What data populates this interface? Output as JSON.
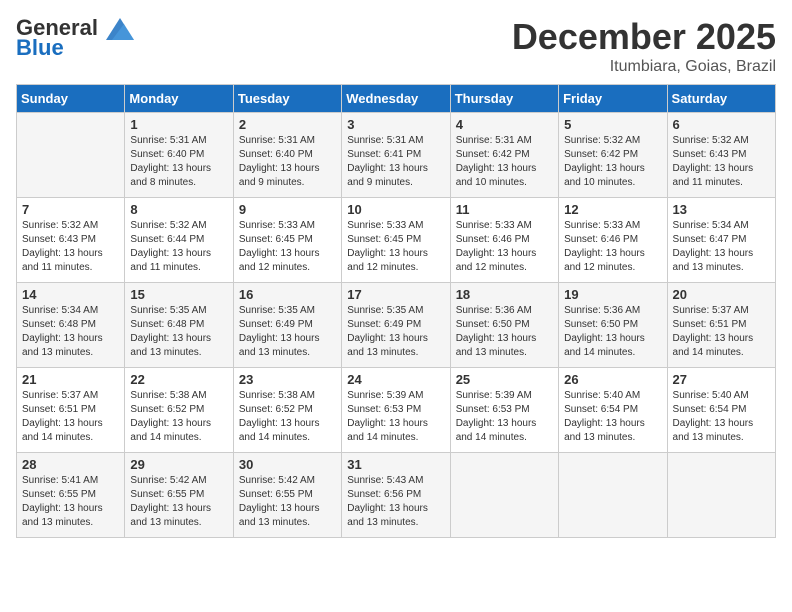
{
  "logo": {
    "line1": "General",
    "line2": "Blue"
  },
  "title": "December 2025",
  "location": "Itumbiara, Goias, Brazil",
  "days_of_week": [
    "Sunday",
    "Monday",
    "Tuesday",
    "Wednesday",
    "Thursday",
    "Friday",
    "Saturday"
  ],
  "weeks": [
    [
      {
        "num": "",
        "sunrise": "",
        "sunset": "",
        "daylight": ""
      },
      {
        "num": "1",
        "sunrise": "Sunrise: 5:31 AM",
        "sunset": "Sunset: 6:40 PM",
        "daylight": "Daylight: 13 hours and 8 minutes."
      },
      {
        "num": "2",
        "sunrise": "Sunrise: 5:31 AM",
        "sunset": "Sunset: 6:40 PM",
        "daylight": "Daylight: 13 hours and 9 minutes."
      },
      {
        "num": "3",
        "sunrise": "Sunrise: 5:31 AM",
        "sunset": "Sunset: 6:41 PM",
        "daylight": "Daylight: 13 hours and 9 minutes."
      },
      {
        "num": "4",
        "sunrise": "Sunrise: 5:31 AM",
        "sunset": "Sunset: 6:42 PM",
        "daylight": "Daylight: 13 hours and 10 minutes."
      },
      {
        "num": "5",
        "sunrise": "Sunrise: 5:32 AM",
        "sunset": "Sunset: 6:42 PM",
        "daylight": "Daylight: 13 hours and 10 minutes."
      },
      {
        "num": "6",
        "sunrise": "Sunrise: 5:32 AM",
        "sunset": "Sunset: 6:43 PM",
        "daylight": "Daylight: 13 hours and 11 minutes."
      }
    ],
    [
      {
        "num": "7",
        "sunrise": "Sunrise: 5:32 AM",
        "sunset": "Sunset: 6:43 PM",
        "daylight": "Daylight: 13 hours and 11 minutes."
      },
      {
        "num": "8",
        "sunrise": "Sunrise: 5:32 AM",
        "sunset": "Sunset: 6:44 PM",
        "daylight": "Daylight: 13 hours and 11 minutes."
      },
      {
        "num": "9",
        "sunrise": "Sunrise: 5:33 AM",
        "sunset": "Sunset: 6:45 PM",
        "daylight": "Daylight: 13 hours and 12 minutes."
      },
      {
        "num": "10",
        "sunrise": "Sunrise: 5:33 AM",
        "sunset": "Sunset: 6:45 PM",
        "daylight": "Daylight: 13 hours and 12 minutes."
      },
      {
        "num": "11",
        "sunrise": "Sunrise: 5:33 AM",
        "sunset": "Sunset: 6:46 PM",
        "daylight": "Daylight: 13 hours and 12 minutes."
      },
      {
        "num": "12",
        "sunrise": "Sunrise: 5:33 AM",
        "sunset": "Sunset: 6:46 PM",
        "daylight": "Daylight: 13 hours and 12 minutes."
      },
      {
        "num": "13",
        "sunrise": "Sunrise: 5:34 AM",
        "sunset": "Sunset: 6:47 PM",
        "daylight": "Daylight: 13 hours and 13 minutes."
      }
    ],
    [
      {
        "num": "14",
        "sunrise": "Sunrise: 5:34 AM",
        "sunset": "Sunset: 6:48 PM",
        "daylight": "Daylight: 13 hours and 13 minutes."
      },
      {
        "num": "15",
        "sunrise": "Sunrise: 5:35 AM",
        "sunset": "Sunset: 6:48 PM",
        "daylight": "Daylight: 13 hours and 13 minutes."
      },
      {
        "num": "16",
        "sunrise": "Sunrise: 5:35 AM",
        "sunset": "Sunset: 6:49 PM",
        "daylight": "Daylight: 13 hours and 13 minutes."
      },
      {
        "num": "17",
        "sunrise": "Sunrise: 5:35 AM",
        "sunset": "Sunset: 6:49 PM",
        "daylight": "Daylight: 13 hours and 13 minutes."
      },
      {
        "num": "18",
        "sunrise": "Sunrise: 5:36 AM",
        "sunset": "Sunset: 6:50 PM",
        "daylight": "Daylight: 13 hours and 13 minutes."
      },
      {
        "num": "19",
        "sunrise": "Sunrise: 5:36 AM",
        "sunset": "Sunset: 6:50 PM",
        "daylight": "Daylight: 13 hours and 14 minutes."
      },
      {
        "num": "20",
        "sunrise": "Sunrise: 5:37 AM",
        "sunset": "Sunset: 6:51 PM",
        "daylight": "Daylight: 13 hours and 14 minutes."
      }
    ],
    [
      {
        "num": "21",
        "sunrise": "Sunrise: 5:37 AM",
        "sunset": "Sunset: 6:51 PM",
        "daylight": "Daylight: 13 hours and 14 minutes."
      },
      {
        "num": "22",
        "sunrise": "Sunrise: 5:38 AM",
        "sunset": "Sunset: 6:52 PM",
        "daylight": "Daylight: 13 hours and 14 minutes."
      },
      {
        "num": "23",
        "sunrise": "Sunrise: 5:38 AM",
        "sunset": "Sunset: 6:52 PM",
        "daylight": "Daylight: 13 hours and 14 minutes."
      },
      {
        "num": "24",
        "sunrise": "Sunrise: 5:39 AM",
        "sunset": "Sunset: 6:53 PM",
        "daylight": "Daylight: 13 hours and 14 minutes."
      },
      {
        "num": "25",
        "sunrise": "Sunrise: 5:39 AM",
        "sunset": "Sunset: 6:53 PM",
        "daylight": "Daylight: 13 hours and 14 minutes."
      },
      {
        "num": "26",
        "sunrise": "Sunrise: 5:40 AM",
        "sunset": "Sunset: 6:54 PM",
        "daylight": "Daylight: 13 hours and 13 minutes."
      },
      {
        "num": "27",
        "sunrise": "Sunrise: 5:40 AM",
        "sunset": "Sunset: 6:54 PM",
        "daylight": "Daylight: 13 hours and 13 minutes."
      }
    ],
    [
      {
        "num": "28",
        "sunrise": "Sunrise: 5:41 AM",
        "sunset": "Sunset: 6:55 PM",
        "daylight": "Daylight: 13 hours and 13 minutes."
      },
      {
        "num": "29",
        "sunrise": "Sunrise: 5:42 AM",
        "sunset": "Sunset: 6:55 PM",
        "daylight": "Daylight: 13 hours and 13 minutes."
      },
      {
        "num": "30",
        "sunrise": "Sunrise: 5:42 AM",
        "sunset": "Sunset: 6:55 PM",
        "daylight": "Daylight: 13 hours and 13 minutes."
      },
      {
        "num": "31",
        "sunrise": "Sunrise: 5:43 AM",
        "sunset": "Sunset: 6:56 PM",
        "daylight": "Daylight: 13 hours and 13 minutes."
      },
      {
        "num": "",
        "sunrise": "",
        "sunset": "",
        "daylight": ""
      },
      {
        "num": "",
        "sunrise": "",
        "sunset": "",
        "daylight": ""
      },
      {
        "num": "",
        "sunrise": "",
        "sunset": "",
        "daylight": ""
      }
    ]
  ]
}
